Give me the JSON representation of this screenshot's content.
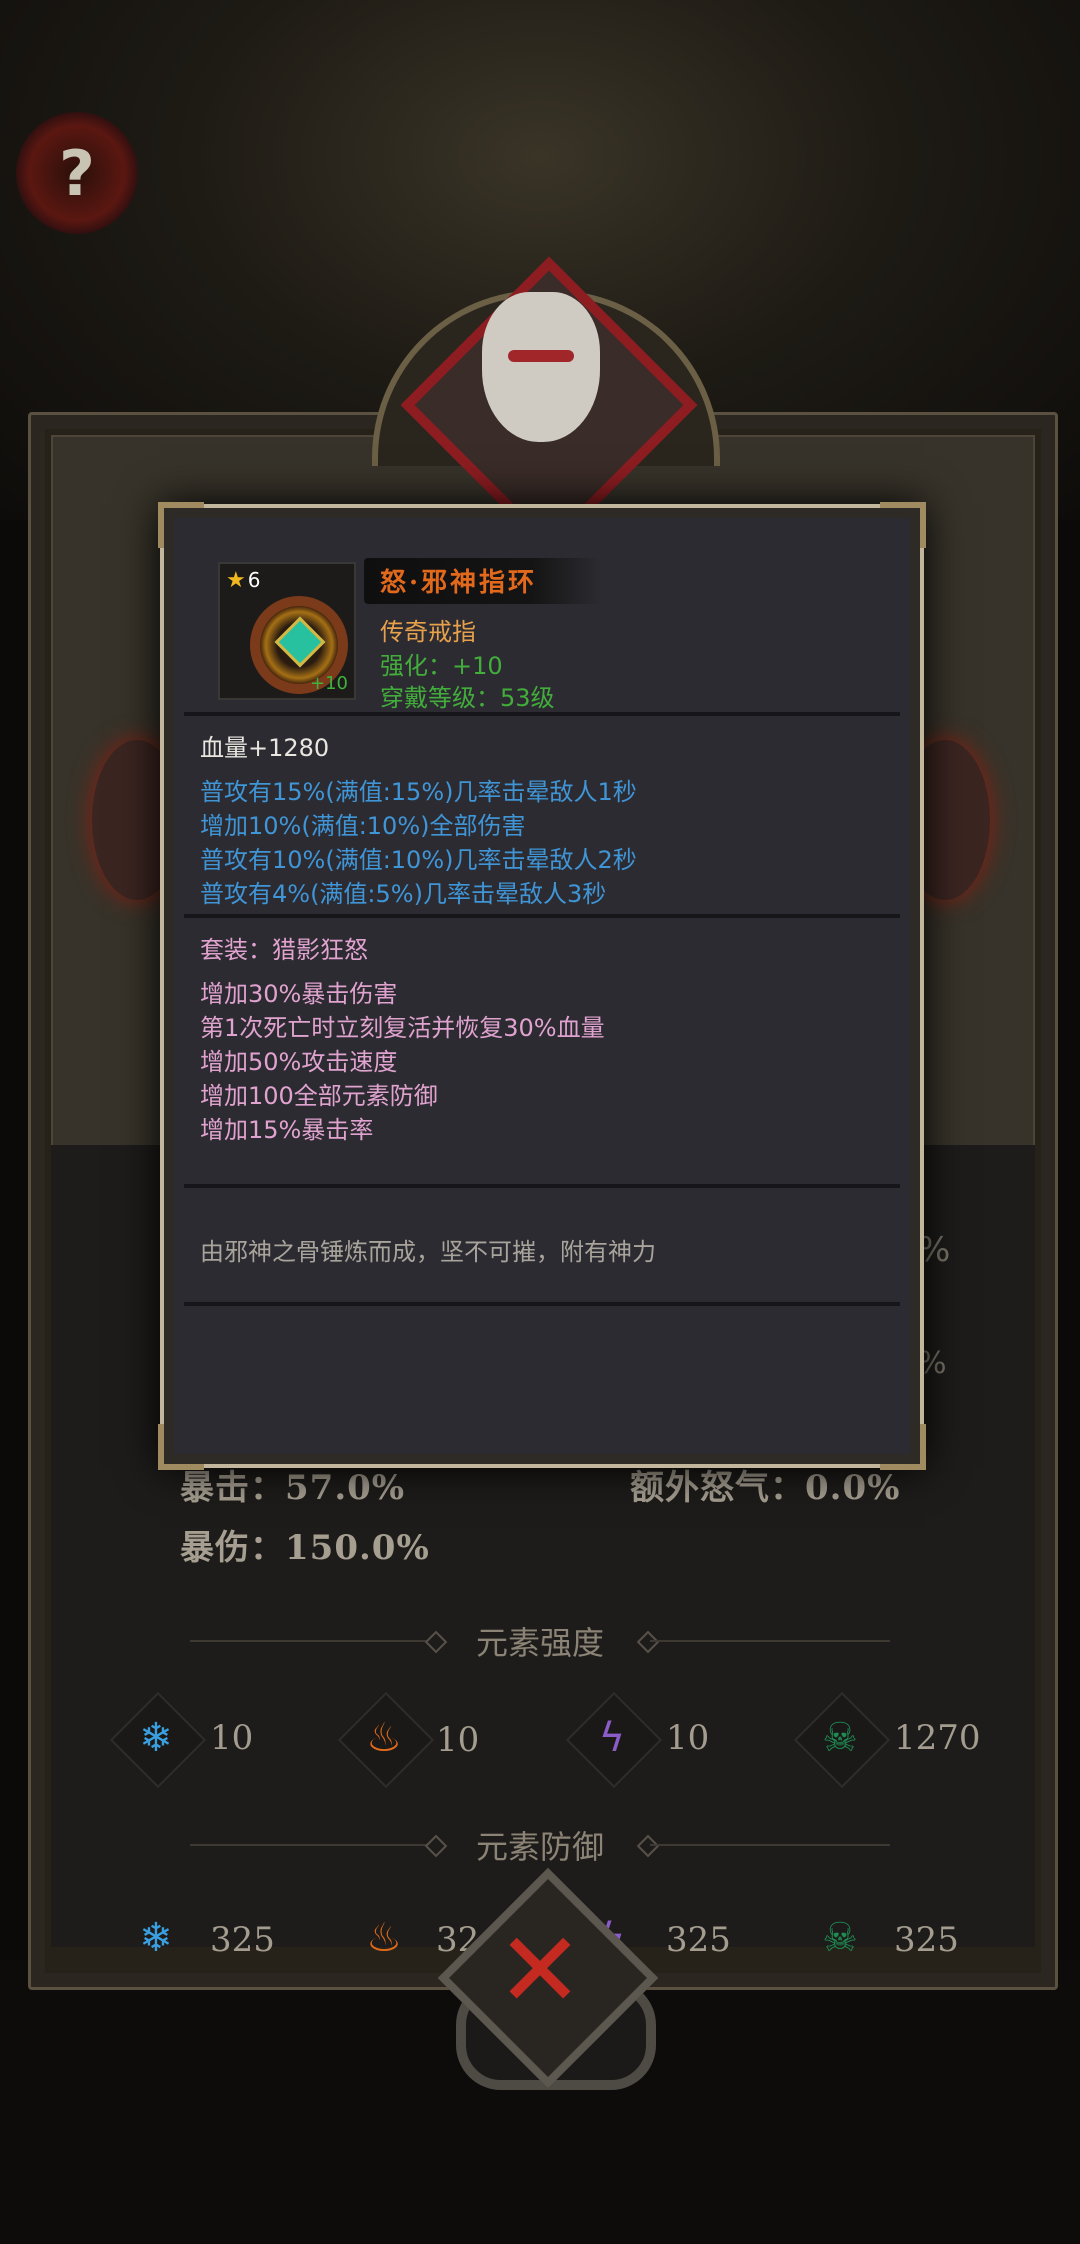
{
  "help": {
    "label": "?"
  },
  "item": {
    "stars": "6",
    "level_tag": "+10",
    "name": "怒·邪神指环",
    "type": "传奇戒指",
    "enhance": "强化：+10",
    "wear_level": "穿戴等级：53级"
  },
  "attributes": {
    "base": "血量+1280",
    "affixes": [
      "普攻有15%(满值:15%)几率击晕敌人1秒",
      "增加10%(满值:10%)全部伤害",
      "普攻有10%(满值:10%)几率击晕敌人2秒",
      "普攻有4%(满值:5%)几率击晕敌人3秒"
    ]
  },
  "set_bonus": {
    "title": "套装：猎影狂怒",
    "effects": [
      "增加30%暴击伤害",
      "第1次死亡时立刻复活并恢复30%血量",
      "增加50%攻击速度",
      "增加100全部元素防御",
      "增加15%暴击率"
    ]
  },
  "flavor": "由邪神之骨锤炼而成，坚不可摧，附有神力",
  "stats": {
    "crit": "暴击：57.0%",
    "extra_rage": "额外怒气：0.0%",
    "crit_dmg": "暴伤：150.0%",
    "pct_fragment_1": "%",
    "pct_fragment_2": "%"
  },
  "element_strength": {
    "title": "元素强度",
    "values": [
      "10",
      "10",
      "10",
      "1270"
    ]
  },
  "element_defense": {
    "title": "元素防御",
    "values": [
      "325",
      "32",
      "325",
      "325"
    ]
  },
  "close": {
    "label": "✕"
  },
  "colors": {
    "legend_orange": "#e2691c",
    "affix_blue": "#3f95d6",
    "set_pink": "#e0a3cf",
    "enhance_green": "#42ad3b"
  },
  "icons": [
    "ice-icon",
    "fire-icon",
    "lightning-icon",
    "poison-skull-icon"
  ]
}
